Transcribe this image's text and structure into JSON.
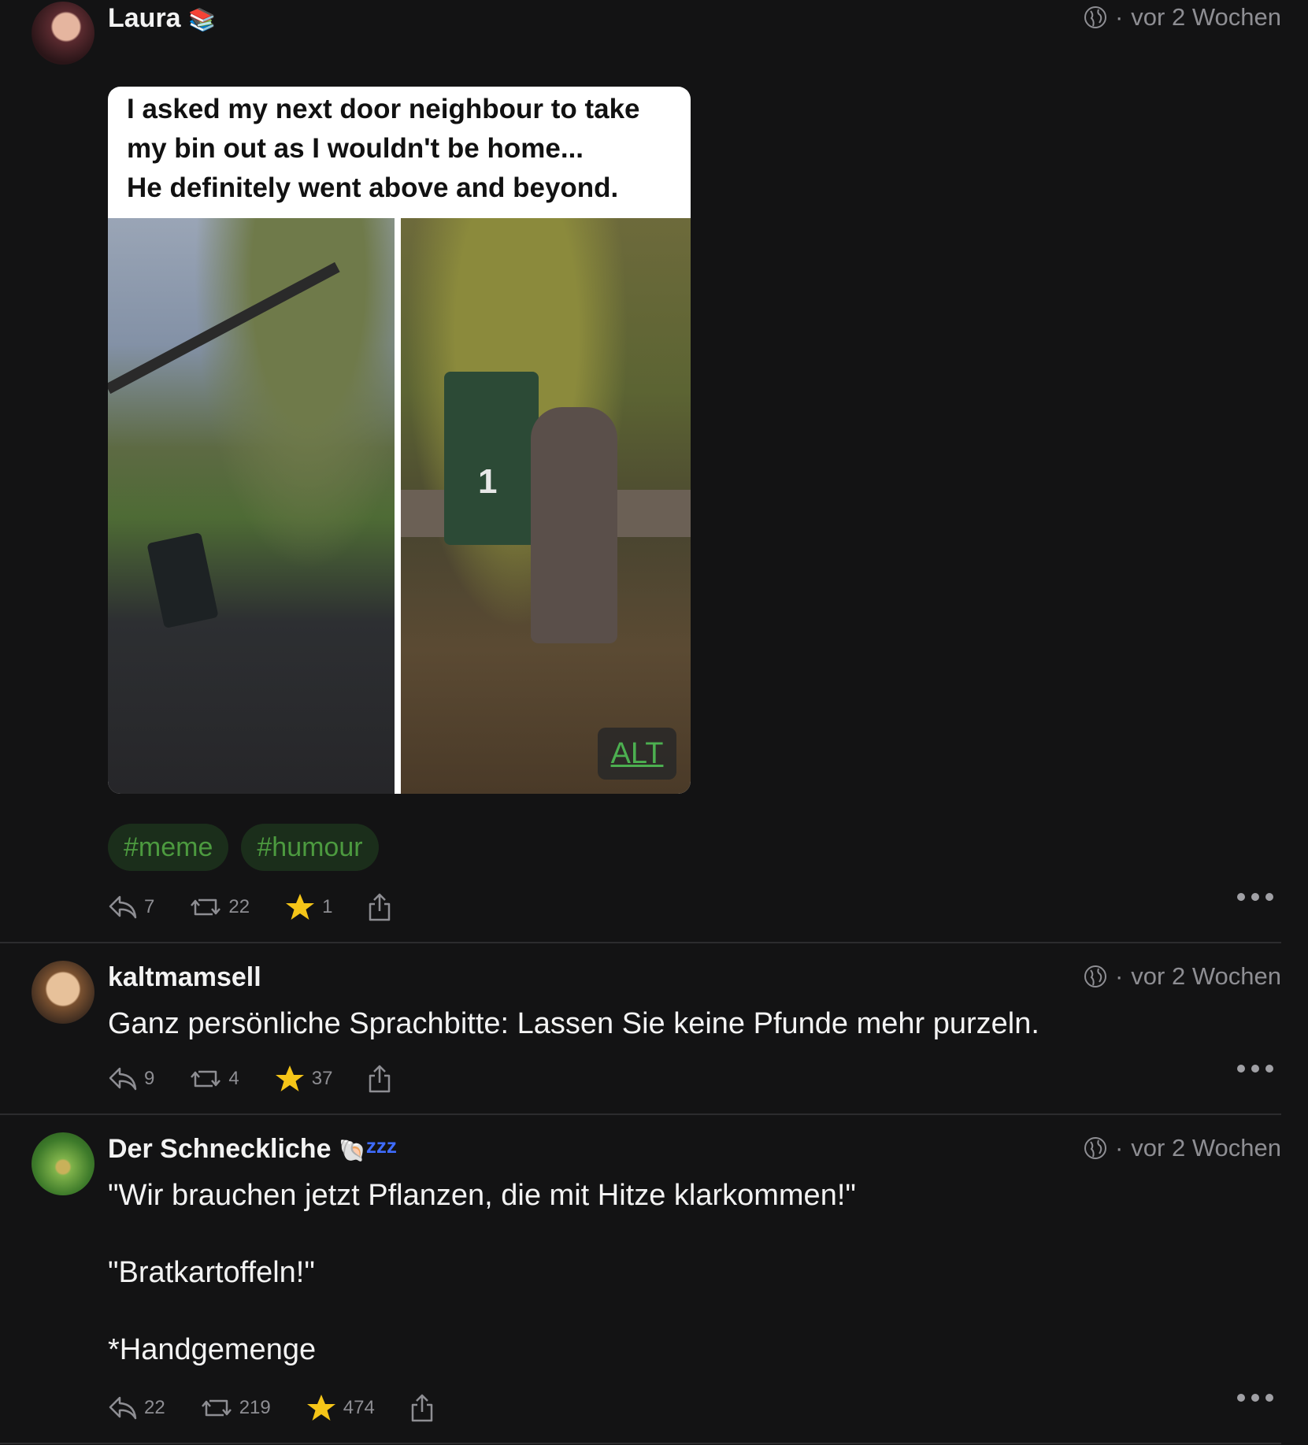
{
  "posts": [
    {
      "author": "Laura",
      "author_emoji": "📚",
      "time": "vor 2 Wochen",
      "media": {
        "caption": "I asked my next door neighbour to take\nmy bin out as I wouldn't be home...\nHe definitely went above and beyond.",
        "bin_number": "1",
        "alt_label": "ALT"
      },
      "tags": [
        "#meme",
        "#humour"
      ],
      "actions": {
        "replies": "7",
        "boosts": "22",
        "favourites": "1"
      }
    },
    {
      "author": "kaltmamsell",
      "time": "vor 2 Wochen",
      "text": "Ganz persönliche Sprachbitte: Lassen Sie keine Pfunde mehr purzeln.",
      "actions": {
        "replies": "9",
        "boosts": "4",
        "favourites": "37"
      }
    },
    {
      "author": "Der Schneckliche",
      "author_emoji": "🐚",
      "author_zz": "zzz",
      "time": "vor 2 Wochen",
      "text": "\"Wir brauchen jetzt Pflanzen, die mit Hitze klarkommen!\"\n\n\"Bratkartoffeln!\"\n\n*Handgemenge",
      "actions": {
        "replies": "22",
        "boosts": "219",
        "favourites": "474"
      }
    }
  ],
  "colors": {
    "background": "#131314",
    "tag_bg": "#1b2e1b",
    "tag_text": "#4c9a3f",
    "star": "#f5c518"
  }
}
